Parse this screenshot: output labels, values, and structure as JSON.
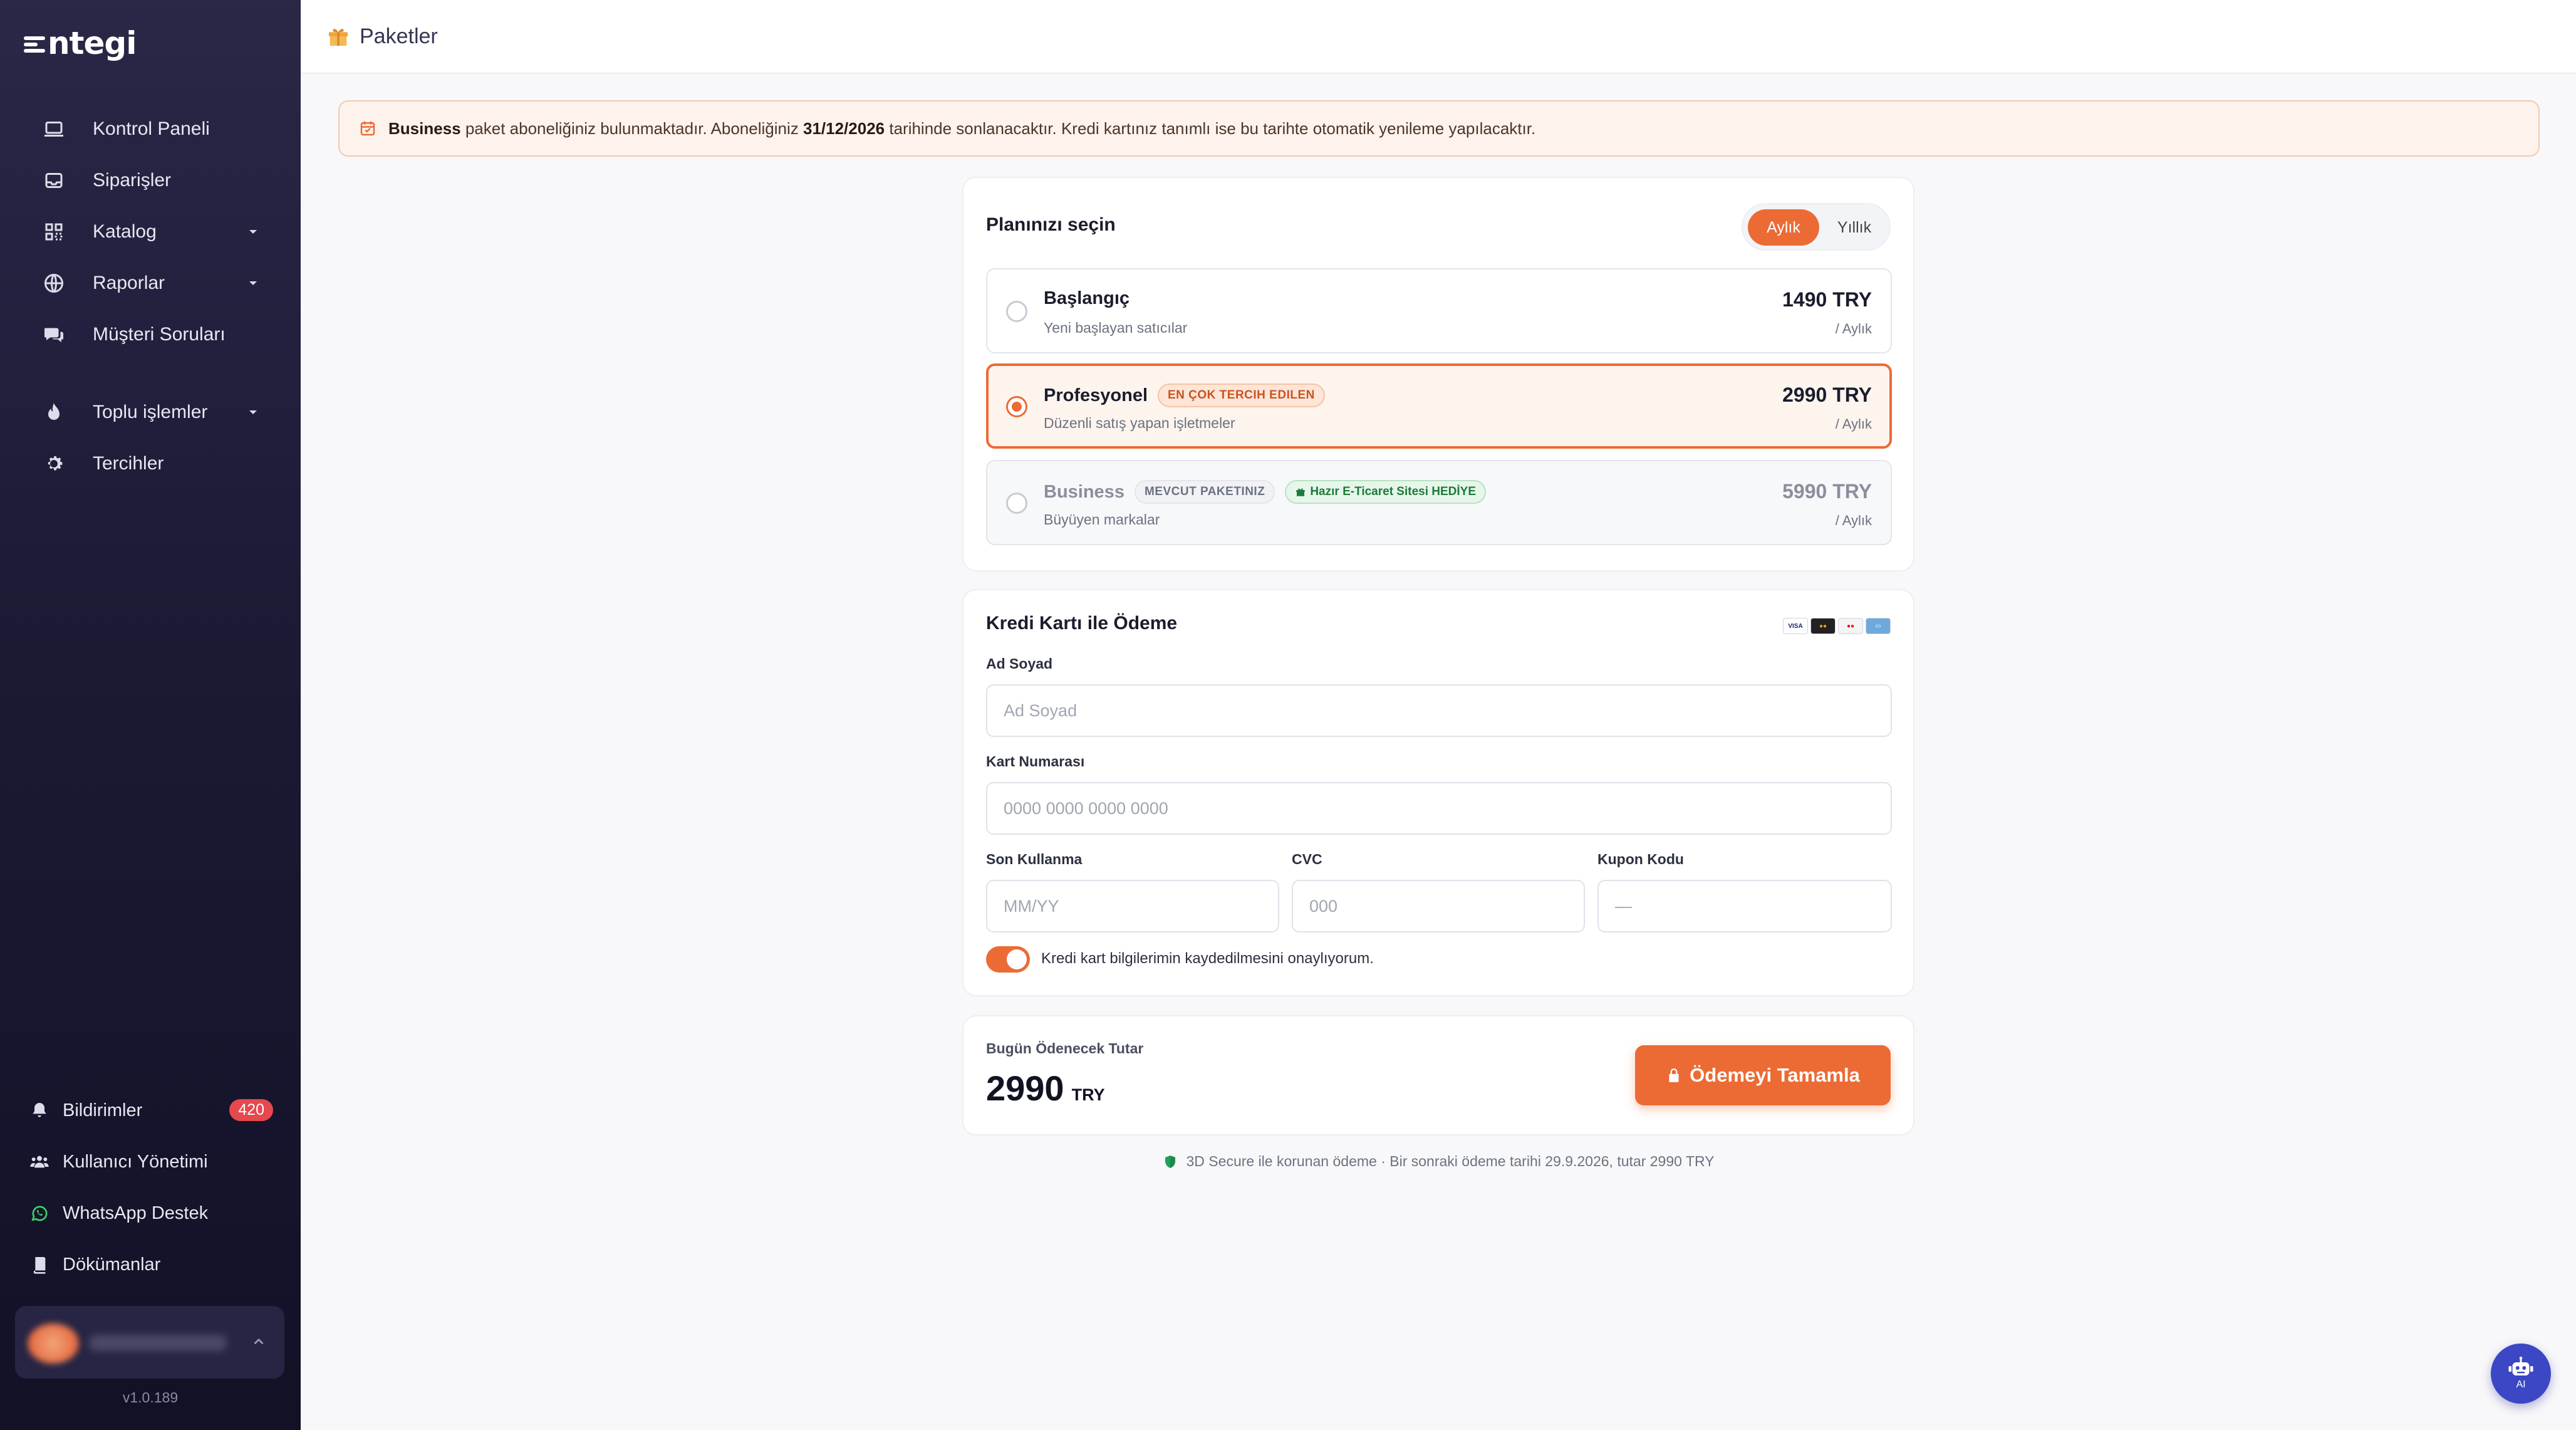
{
  "sidebar": {
    "logo": "ntegi",
    "nav": [
      {
        "label": "Kontrol Paneli",
        "icon": "laptop-icon"
      },
      {
        "label": "Siparişler",
        "icon": "inbox-icon"
      },
      {
        "label": "Katalog",
        "icon": "grid-icon",
        "expandable": true
      },
      {
        "label": "Raporlar",
        "icon": "globe-icon",
        "expandable": true
      },
      {
        "label": "Müşteri Soruları",
        "icon": "chat-icon"
      },
      {
        "label": "Toplu işlemler",
        "icon": "flame-icon",
        "expandable": true
      },
      {
        "label": "Tercihler",
        "icon": "gear-icon"
      }
    ],
    "bottom": {
      "notifications": {
        "label": "Bildirimler",
        "count": "420"
      },
      "users": {
        "label": "Kullanıcı Yönetimi"
      },
      "whatsapp": {
        "label": "WhatsApp Destek"
      },
      "docs": {
        "label": "Dökümanlar"
      }
    },
    "version": "v1.0.189"
  },
  "header": {
    "title": "Paketler"
  },
  "alert": {
    "plan": "Business",
    "text1": " paket aboneliğiniz bulunmaktadır. Aboneliğiniz ",
    "date": "31/12/2026",
    "text2": " tarihinde sonlanacaktır. Kredi kartınız tanımlı ise bu tarihte otomatik yenileme yapılacaktır."
  },
  "plans": {
    "title": "Planınızı seçin",
    "toggle": {
      "monthly": "Aylık",
      "yearly": "Yıllık",
      "selected": "monthly"
    },
    "items": [
      {
        "name": "Başlangıç",
        "desc": "Yeni başlayan satıcılar",
        "price": "1490 TRY",
        "period": "/ Aylık",
        "state": "default"
      },
      {
        "name": "Profesyonel",
        "badge": "EN ÇOK TERCIH EDILEN",
        "desc": "Düzenli satış yapan işletmeler",
        "price": "2990 TRY",
        "period": "/ Aylık",
        "state": "selected"
      },
      {
        "name": "Business",
        "badge": "MEVCUT PAKETINIZ",
        "badge2": "Hazır E-Ticaret Sitesi HEDİYE",
        "desc": "Büyüyen markalar",
        "price": "5990 TRY",
        "period": "/ Aylık",
        "state": "disabled"
      }
    ]
  },
  "payment": {
    "title": "Kredi Kartı ile Ödeme",
    "card_brands": [
      "VISA",
      "MC",
      "MC",
      "AMEX"
    ],
    "name_label": "Ad Soyad",
    "name_placeholder": "Ad Soyad",
    "number_label": "Kart Numarası",
    "number_placeholder": "0000 0000 0000 0000",
    "expiry_label": "Son Kullanma",
    "expiry_placeholder": "MM/YY",
    "cvc_label": "CVC",
    "cvc_placeholder": "000",
    "coupon_label": "Kupon Kodu",
    "coupon_placeholder": "—",
    "save_card_label": "Kredi kart bilgilerimin kaydedilmesini onaylıyorum.",
    "save_card_on": true
  },
  "summary": {
    "label": "Bugün Ödenecek Tutar",
    "amount": "2990",
    "currency": "TRY",
    "button": "Ödemeyi Tamamla"
  },
  "secure_note": "3D Secure ile korunan ödeme · Bir sonraki ödeme tarihi 29.9.2026, tutar 2990 TRY",
  "ai_button": "AI",
  "colors": {
    "accent": "#ec6b35",
    "sidebar": "#1b1a35",
    "ai": "#3b47c4"
  }
}
